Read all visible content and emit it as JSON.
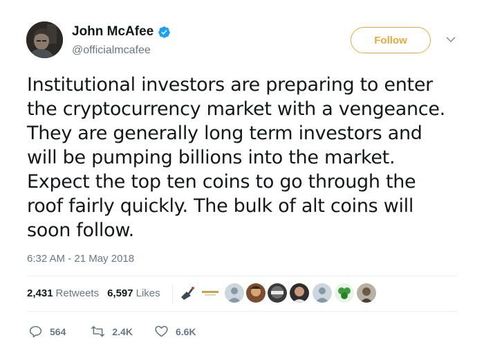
{
  "author": {
    "display_name": "John McAfee",
    "handle": "@officialmcafee",
    "verified": true,
    "avatar": "profile-photo"
  },
  "follow_button": {
    "label": "Follow",
    "color": "#e8a93c"
  },
  "menu": {
    "icon": "chevron-down-icon"
  },
  "tweet": {
    "text": "Institutional investors are preparing to enter\nthe cryptocurrency market with a vengeance.\nThey are generally long term investors and\nwill be pumping billions into the market.\nExpect the top ten coins to go through the\nroof fairly quickly. The bulk of alt coins will\nsoon follow.",
    "timestamp": "6:32 AM - 21 May 2018"
  },
  "stats": {
    "retweets_count": "2,431",
    "retweets_label": "Retweets",
    "likes_count": "6,597",
    "likes_label": "Likes"
  },
  "actions": {
    "replies": {
      "icon": "reply-icon",
      "count": "564"
    },
    "retweets": {
      "icon": "retweet-icon",
      "count": "2.4K"
    },
    "likes": {
      "icon": "heart-icon",
      "count": "6.6K"
    }
  },
  "colors": {
    "text": "#14171a",
    "secondary": "#657786",
    "verified": "#1da1f2",
    "divider": "#e6ecf0"
  }
}
